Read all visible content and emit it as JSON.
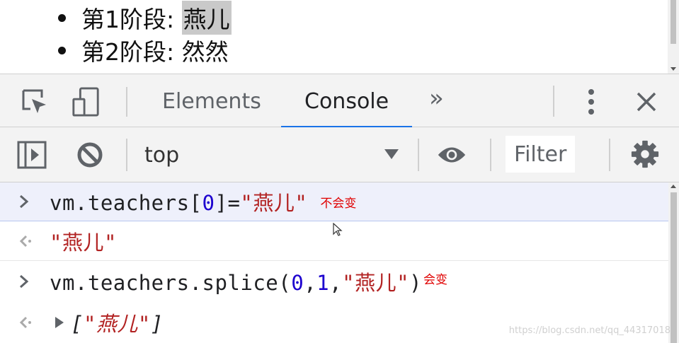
{
  "page": {
    "items": [
      {
        "prefix": "第1阶段: ",
        "name": "燕儿"
      },
      {
        "prefix": "第2阶段: ",
        "name": "然然"
      }
    ]
  },
  "devtools": {
    "tabs": [
      {
        "label": "Elements"
      },
      {
        "label": "Console"
      }
    ],
    "more_tabs": "»"
  },
  "toolbar": {
    "context": "top",
    "filter_placeholder": "Filter"
  },
  "console": {
    "entries": [
      {
        "type": "input",
        "code_a": "vm.teachers[",
        "code_num": "0",
        "code_b": "]=",
        "code_str": "\"燕儿\"",
        "note": "不会变"
      },
      {
        "type": "output",
        "value": "\"燕儿\""
      },
      {
        "type": "input",
        "code_a": "vm.teachers.splice(",
        "num1": "0",
        "comma1": ",",
        "num2": "1",
        "comma2": ",",
        "code_str": "\"燕儿\"",
        "code_b": ")",
        "note": "会变"
      },
      {
        "type": "output",
        "open": "[",
        "value": "\"燕儿\"",
        "close": "]"
      }
    ]
  },
  "watermark": "https://blog.csdn.net/qq_44317018",
  "colors": {
    "accent": "#1a73e8",
    "string": "#b22222",
    "number": "#1c00cf",
    "note": "#e00000"
  }
}
